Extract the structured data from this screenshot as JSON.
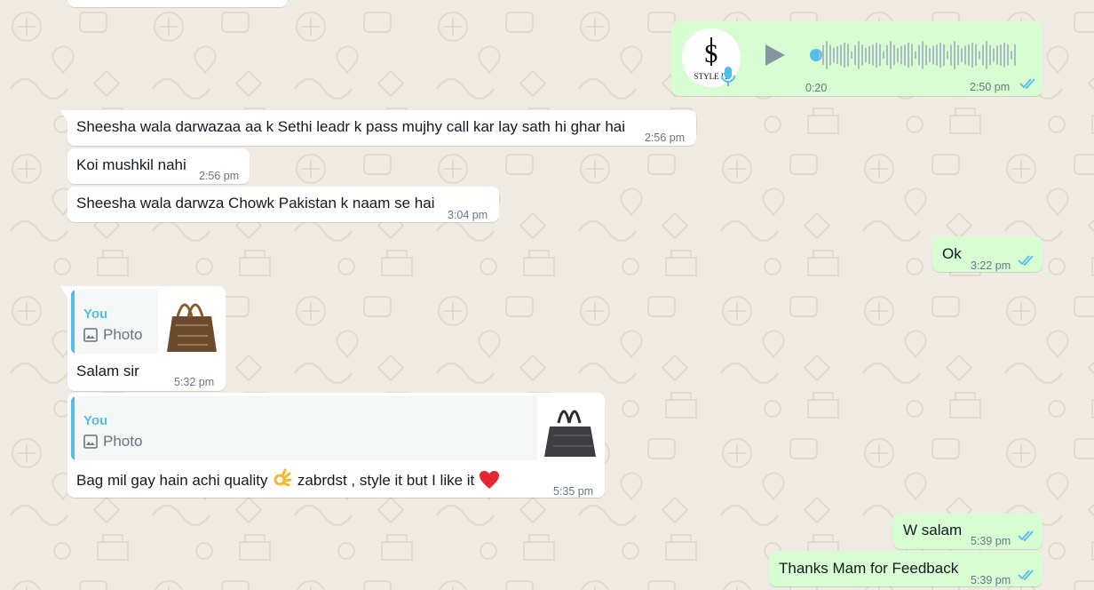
{
  "chat": {
    "messages": [
      {
        "id": "voice",
        "direction": "out",
        "duration": "0:20",
        "time": "2:50 pm",
        "avatar_text": "STYLE IT"
      },
      {
        "id": "m1",
        "direction": "in",
        "text": "Sheesha wala darwazaa aa k Sethi leadr  k pass mujhy call kar lay sath hi ghar hai",
        "time": "2:56 pm"
      },
      {
        "id": "m2",
        "direction": "in",
        "text": "Koi mushkil nahi",
        "time": "2:56 pm"
      },
      {
        "id": "m3",
        "direction": "in",
        "text": "Sheesha wala darwza Chowk Pakistan  k naam se hai",
        "time": "3:04 pm"
      },
      {
        "id": "m4",
        "direction": "out",
        "text": "Ok",
        "time": "3:22 pm"
      },
      {
        "id": "m5",
        "direction": "in",
        "quote_author": "You",
        "quote_type": "Photo",
        "text": "Salam sir",
        "time": "5:32 pm"
      },
      {
        "id": "m6",
        "direction": "in",
        "quote_author": "You",
        "quote_type": "Photo",
        "text_parts": [
          "Bag mil gay hain   achi quality ",
          "  zabrdst ,   style it but I like it"
        ],
        "time": "5:35 pm"
      },
      {
        "id": "m7",
        "direction": "out",
        "text": "W salam",
        "time": "5:39 pm"
      },
      {
        "id": "m8",
        "direction": "out",
        "text": "Thanks Mam for Feedback",
        "time": "5:39 pm"
      }
    ]
  },
  "colors": {
    "background": "#efeae2",
    "incoming_bubble": "#ffffff",
    "outgoing_bubble": "#d9fdd3",
    "read_ticks": "#53bdeb",
    "quote_accent": "#53bdeb"
  },
  "icons": [
    "play-icon",
    "mic-icon",
    "photo-icon",
    "read-ticks-icon",
    "ok-hand-emoji",
    "red-heart-emoji"
  ]
}
